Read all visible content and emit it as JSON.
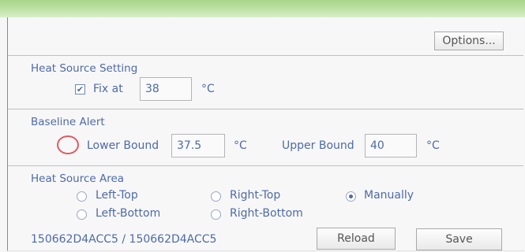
{
  "toolbar": {
    "options_label": "Options..."
  },
  "heat_source_setting": {
    "title": "Heat Source Setting",
    "fix_at_label": "Fix at",
    "fix_at_checked": true,
    "fix_at_value": "38",
    "unit": "°C"
  },
  "baseline_alert": {
    "title": "Baseline Alert",
    "lower_label": "Lower Bound",
    "lower_value": "37.5",
    "lower_unit": "°C",
    "upper_label": "Upper Bound",
    "upper_value": "40",
    "upper_unit": "°C"
  },
  "heat_source_area": {
    "title": "Heat Source Area",
    "options": {
      "left_top": "Left-Top",
      "right_top": "Right-Top",
      "manually": "Manually",
      "left_bottom": "Left-Bottom",
      "right_bottom": "Right-Bottom"
    },
    "selected": "Manually"
  },
  "footer": {
    "device_ids": "150662D4ACC5 / 150662D4ACC5",
    "reload_label": "Reload",
    "save_label": "Save"
  },
  "colors": {
    "accent": "#4e6aa8",
    "topbar": "#b7dd9a",
    "alert_marker": "#e05a63"
  }
}
